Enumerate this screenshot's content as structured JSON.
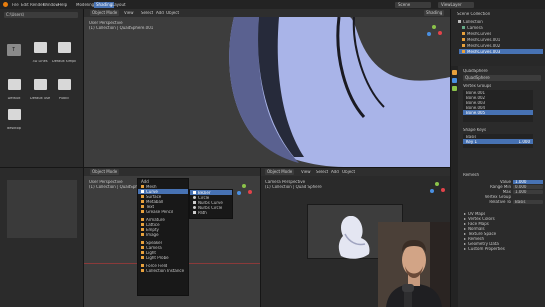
{
  "topbar": {
    "menus": [
      "File",
      "Edit",
      "Render",
      "Window",
      "Help"
    ],
    "tabs": [
      "Modeling",
      "Shading",
      "Layout"
    ],
    "active_tab": "Shading",
    "scene_label": "Scene",
    "view_layer_label": "ViewLayer"
  },
  "file_browser": {
    "path": "C:\\Users\\",
    "items": [
      {
        "label": "3D Lines",
        "kind": "folder"
      },
      {
        "label": "Default simple",
        "kind": "folder"
      },
      {
        "label": "Default",
        "kind": "folder"
      },
      {
        "label": "Default user",
        "kind": "folder"
      },
      {
        "label": "Public",
        "kind": "folder"
      },
      {
        "label": "desktop",
        "kind": "folder"
      }
    ]
  },
  "main_viewport": {
    "mode": "Object Mode",
    "menus": [
      "View",
      "Select",
      "Add",
      "Object"
    ],
    "view_label": "User Perspective",
    "collection_label": "(1) Collection | QuadSphere.001",
    "shading_label": "Shading"
  },
  "outliner": {
    "title": "Scene Collection",
    "items": [
      "Collection",
      "Camera",
      "MeshCurves",
      "MeshCurves.001",
      "MeshCurves.002",
      "MeshCurves.003"
    ]
  },
  "properties": {
    "object_name": "QuadSphere",
    "tab_label": "QuadSphere",
    "vertex_groups_title": "Vertex Groups",
    "vertex_groups": [
      "Bone.001",
      "Bone.002",
      "Bone.003",
      "Bone.004",
      "Bone.005"
    ],
    "shape_keys_title": "Shape Keys",
    "shape_keys": [
      "Basis",
      "Key 1"
    ],
    "shape_key_value": "1.000",
    "remesh_title": "Remesh",
    "fields": [
      {
        "label": "Value",
        "value": "1.000"
      },
      {
        "label": "Range Min",
        "value": "0.000"
      },
      {
        "label": "Max",
        "value": "1.000"
      },
      {
        "label": "Vertex Group",
        "value": ""
      },
      {
        "label": "Relative To",
        "value": "Basis"
      }
    ],
    "sections": [
      "UV Maps",
      "Vertex Colors",
      "Face Maps",
      "Normals",
      "Texture Space",
      "Remesh",
      "Geometry Data",
      "Custom Properties"
    ]
  },
  "bottom_viewport": {
    "mode": "Object Mode",
    "view_label": "User Perspective",
    "collection_label": "(1) Collection | QuadSphere.001"
  },
  "add_menu": {
    "title": "Add",
    "items": [
      "Mesh",
      "Curve",
      "Surface",
      "Metaball",
      "Text",
      "Grease Pencil",
      "Armature",
      "Lattice",
      "Empty",
      "Image",
      "Speaker",
      "Camera",
      "Light",
      "Light Probe",
      "Force Field",
      "Collection Instance"
    ],
    "highlighted": "Curve",
    "submenu_items": [
      "Bezier",
      "Circle",
      "Nurbs Curve",
      "Nurbs Circle",
      "Path"
    ],
    "submenu_highlighted": "Bezier"
  },
  "camera_viewport": {
    "mode": "Object Mode",
    "menus": [
      "View",
      "Select",
      "Add",
      "Object"
    ],
    "view_label": "Camera Perspective",
    "collection_label": "(1) Collection | Quad Sphere"
  },
  "colors": {
    "accent": "#4772b3",
    "topbar": "#232323",
    "panel": "#2b2b2b",
    "viewport": "#3d3d3d",
    "figure": "#a9b4e8"
  }
}
